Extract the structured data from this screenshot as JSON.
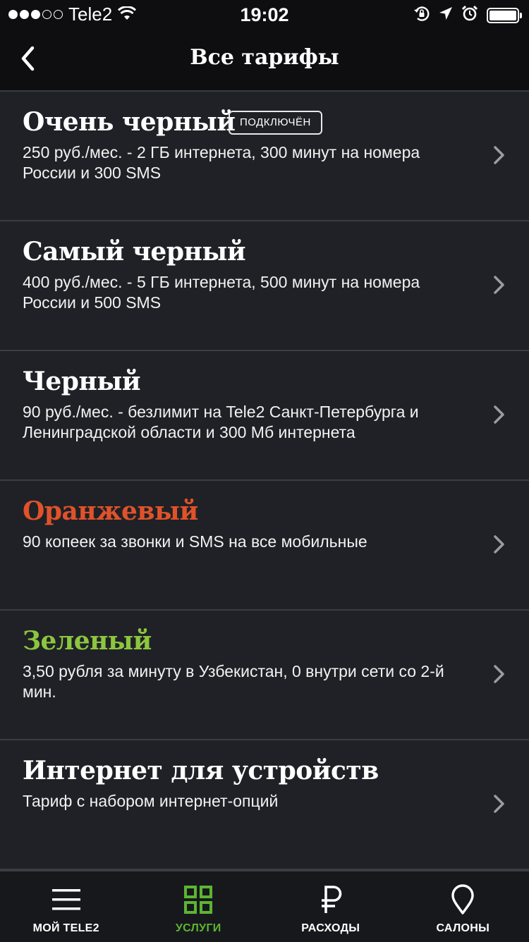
{
  "status_bar": {
    "carrier": "Tele2",
    "time": "19:02",
    "signal_filled": 3,
    "signal_total": 5,
    "battery_level": 1.0
  },
  "header": {
    "title": "Все тарифы",
    "back_icon": "chevron-left-icon"
  },
  "tariffs": [
    {
      "name": "Очень черный",
      "badge": "ПОДКЛЮЧЁН",
      "description": "250 руб./мес. - 2 ГБ интернета, 300 минут на номера России и 300 SMS",
      "name_color": "#ffffff"
    },
    {
      "name": "Самый черный",
      "description": "400 руб./мес. - 5 ГБ интернета, 500 минут на номера России и 500 SMS",
      "name_color": "#ffffff"
    },
    {
      "name": "Черный",
      "description": "90 руб./мес. - безлимит на Tele2 Санкт-Петербурга и Ленинградской области и 300 Мб интернета",
      "name_color": "#ffffff"
    },
    {
      "name": "Оранжевый",
      "description": "90 копеек за звонки и SMS на все мобильные",
      "name_color": "#e0522a"
    },
    {
      "name": "Зеленый",
      "description": "3,50 рубля за минуту в Узбекистан, 0 внутри сети со 2-й мин.",
      "name_color": "#8cc63f"
    },
    {
      "name": "Интернет для устройств",
      "description": "Тариф с набором интернет-опций",
      "name_color": "#ffffff"
    }
  ],
  "tab_bar": {
    "tabs": [
      {
        "label": "МОЙ TELE2",
        "icon": "menu-icon",
        "active": false
      },
      {
        "label": "УСЛУГИ",
        "icon": "grid-icon",
        "active": true
      },
      {
        "label": "РАСХОДЫ",
        "icon": "ruble-icon",
        "active": false
      },
      {
        "label": "САЛОНЫ",
        "icon": "location-pin-icon",
        "active": false
      }
    ],
    "active_color": "#5cb531",
    "inactive_color": "#ffffff"
  }
}
